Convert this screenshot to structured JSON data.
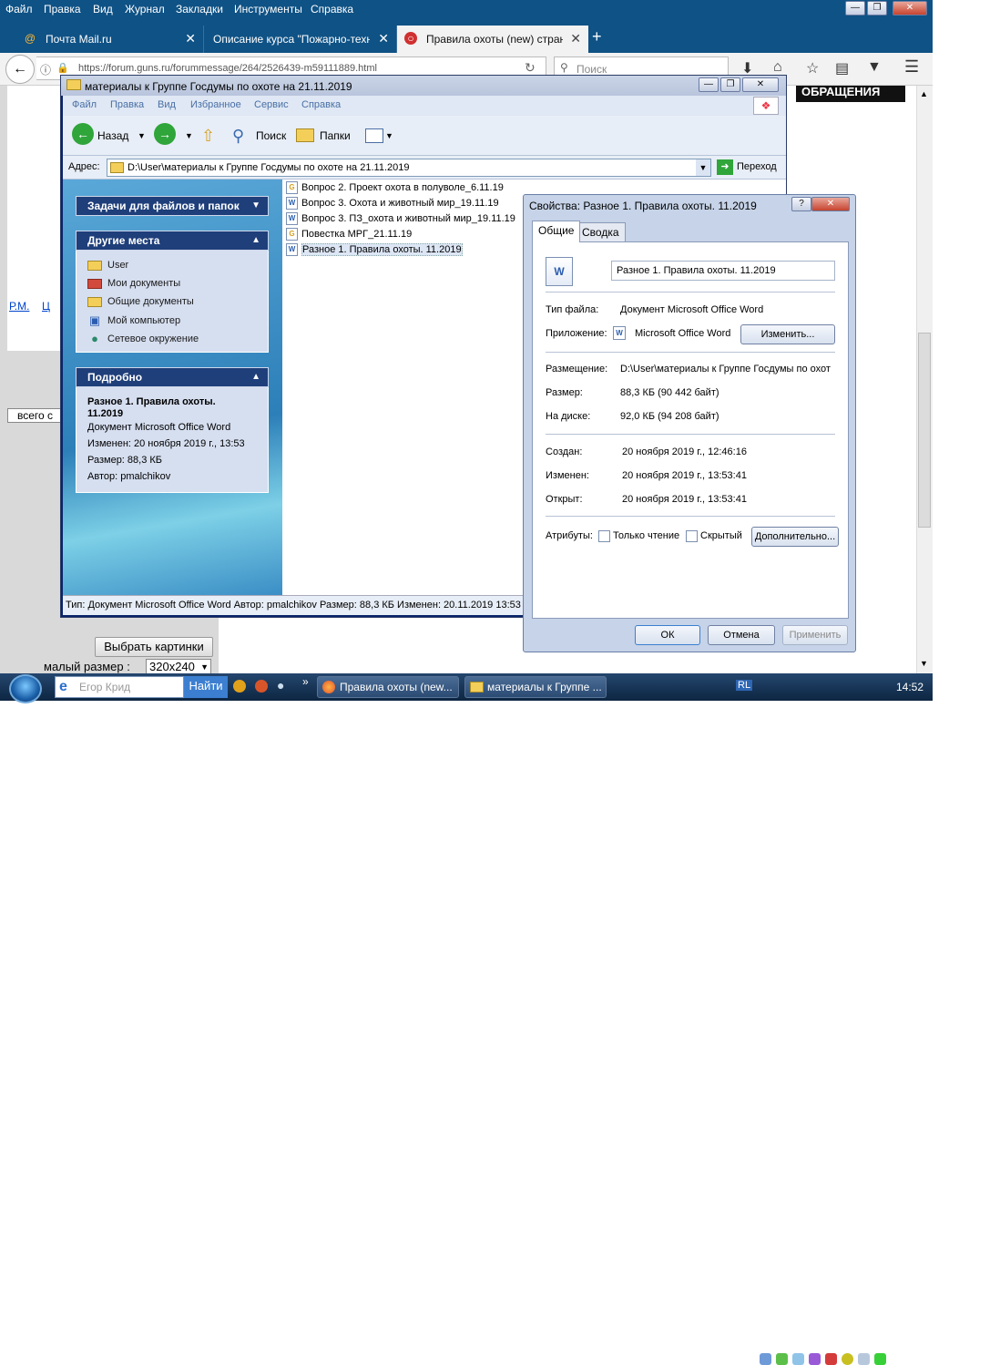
{
  "firefox": {
    "menu": [
      "Файл",
      "Правка",
      "Вид",
      "Журнал",
      "Закладки",
      "Инструменты",
      "Справка"
    ],
    "tabs": [
      {
        "label": "Почта Mail.ru",
        "icon": "at-icon"
      },
      {
        "label": "Описание курса \"Пожарно-техн...",
        "icon": "blank-page-icon"
      },
      {
        "label": "Правила охоты (new) стран...",
        "icon": "guns-logo-icon"
      }
    ],
    "url": "https://forum.guns.ru/forummessage/264/2526439-m59111889.html",
    "search_placeholder": "Поиск"
  },
  "webpage": {
    "banner": "ОБРАЩЕНИЯ",
    "links": [
      "Р.М.",
      "Ц"
    ],
    "vsego": "всего с",
    "pick_pictures": "Выбрать картинки",
    "small_size_label": "малый размер :",
    "small_size_value": "320x240"
  },
  "explorer": {
    "title": "материалы к Группе Госдумы по охоте на 21.11.2019",
    "menu": [
      "Файл",
      "Правка",
      "Вид",
      "Избранное",
      "Сервис",
      "Справка"
    ],
    "toolbar": {
      "back": "Назад",
      "search": "Поиск",
      "folders": "Папки"
    },
    "address_label": "Адрес:",
    "address": "D:\\User\\материалы к Группе Госдумы по охоте на 21.11.2019",
    "go": "Переход",
    "tasks_header": "Задачи для файлов и папок",
    "places_header": "Другие места",
    "places": [
      {
        "label": "User",
        "icon": "folder-icon"
      },
      {
        "label": "Мои документы",
        "icon": "my-documents-icon"
      },
      {
        "label": "Общие документы",
        "icon": "folder-icon"
      },
      {
        "label": "Мой компьютер",
        "icon": "computer-icon"
      },
      {
        "label": "Сетевое окружение",
        "icon": "network-icon"
      }
    ],
    "details_header": "Подробно",
    "details": {
      "name": "Разное 1. Правила охоты. 11.2019",
      "type": "Документ Microsoft Office Word",
      "modified": "Изменен: 20 ноября 2019 г., 13:53",
      "size": "Размер: 88,3 КБ",
      "author": "Автор: pmalchikov"
    },
    "files": [
      {
        "name": "Вопрос 2. Проект охота в полуволе_6.11.19",
        "type": "g"
      },
      {
        "name": "Вопрос 3. Охота и животный мир_19.11.19",
        "type": "w"
      },
      {
        "name": "Вопрос 3. ПЗ_охота и животный мир_19.11.19",
        "type": "w"
      },
      {
        "name": "Повестка МРГ_21.11.19",
        "type": "g"
      },
      {
        "name": "Разное 1. Правила охоты. 11.2019",
        "type": "w"
      }
    ],
    "status": "Тип: Документ Microsoft Office Word Автор: pmalchikov Размер: 88,3 КБ Изменен: 20.11.2019 13:53"
  },
  "props": {
    "title": "Свойства: Разное 1. Правила охоты. 11.2019",
    "tabs": [
      "Общие",
      "Сводка"
    ],
    "filename": "Разное 1. Правила охоты. 11.2019",
    "rows1": [
      {
        "label": "Тип файла:",
        "value": "Документ Microsoft Office Word"
      },
      {
        "label": "Приложение:",
        "value": "Microsoft Office Word"
      }
    ],
    "change_btn": "Изменить...",
    "rows2": [
      {
        "label": "Размещение:",
        "value": "D:\\User\\материалы к Группе Госдумы по охот"
      },
      {
        "label": "Размер:",
        "value": "88,3 КБ (90 442 байт)"
      },
      {
        "label": "На диске:",
        "value": "92,0 КБ (94 208 байт)"
      }
    ],
    "rows3": [
      {
        "label": "Создан:",
        "value": "20 ноября 2019 г., 12:46:16"
      },
      {
        "label": "Изменен:",
        "value": "20 ноября 2019 г., 13:53:41"
      },
      {
        "label": "Открыт:",
        "value": "20 ноября 2019 г., 13:53:41"
      }
    ],
    "attributes_label": "Атрибуты:",
    "readonly": "Только чтение",
    "hidden": "Скрытый",
    "advanced": "Дополнительно...",
    "ok": "ОК",
    "cancel": "Отмена",
    "apply": "Применить"
  },
  "taskbar": {
    "search_placeholder": "Егор Крид",
    "find": "Найти",
    "tasks": [
      {
        "label": "Правила охоты (new...",
        "icon": "firefox-icon"
      },
      {
        "label": "материалы к Группе ...",
        "icon": "folder-icon"
      }
    ],
    "lang": "RL",
    "clock": "14:52"
  }
}
